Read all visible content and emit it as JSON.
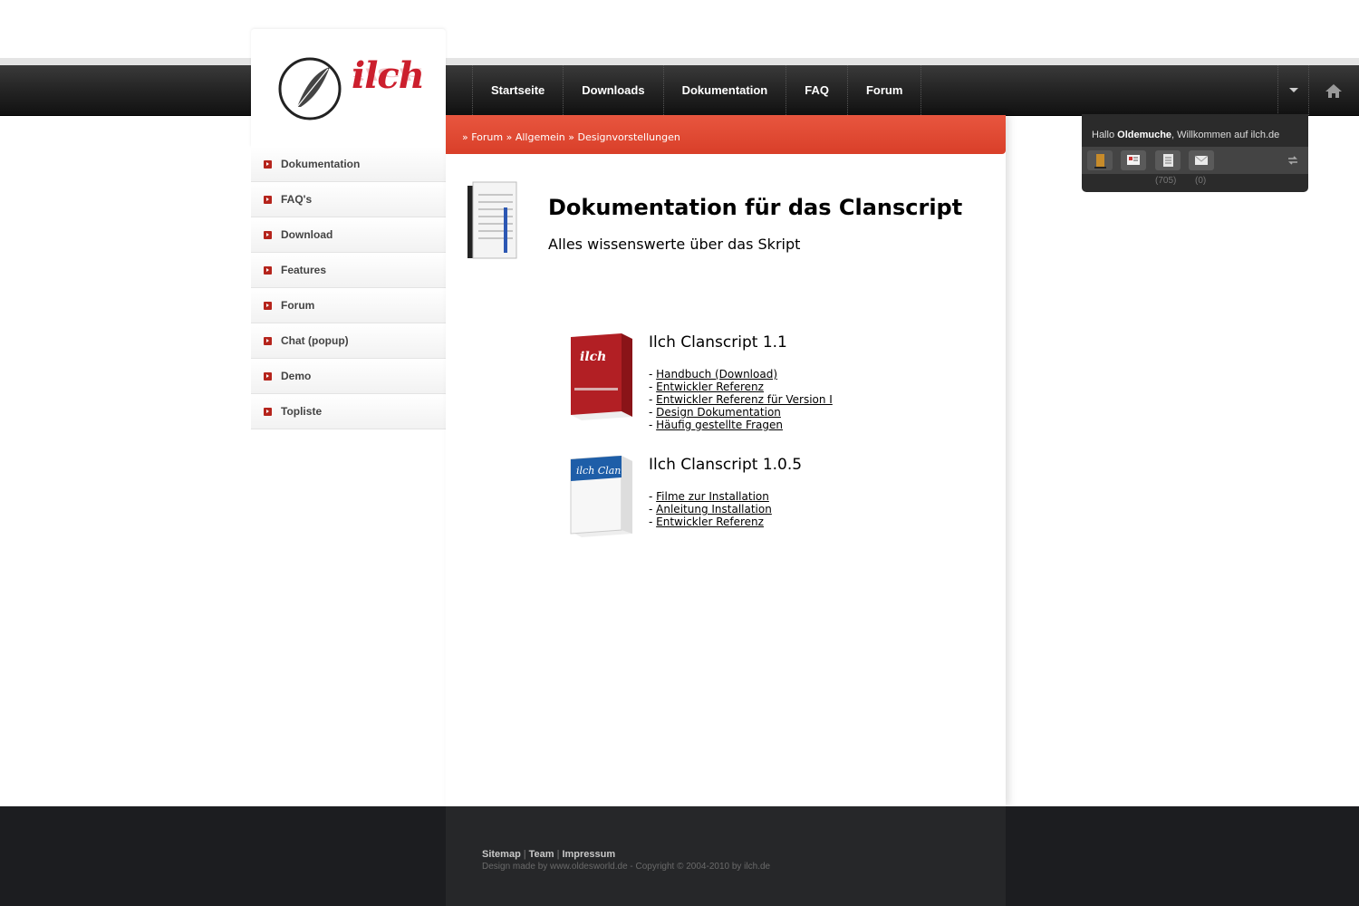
{
  "nav": {
    "items": [
      {
        "label": "Startseite"
      },
      {
        "label": "Downloads"
      },
      {
        "label": "Dokumentation"
      },
      {
        "label": "FAQ"
      },
      {
        "label": "Forum"
      }
    ],
    "dropdown_icon": "chevron-down-icon",
    "home_icon": "home-icon"
  },
  "logo": {
    "text": "ilch"
  },
  "sidebar": {
    "items": [
      {
        "label": "Dokumentation"
      },
      {
        "label": "FAQ's"
      },
      {
        "label": "Download"
      },
      {
        "label": "Features"
      },
      {
        "label": "Forum"
      },
      {
        "label": "Chat (popup)"
      },
      {
        "label": "Demo"
      },
      {
        "label": "Topliste"
      }
    ]
  },
  "breadcrumb": {
    "items": [
      "Forum",
      "Allgemein",
      "Designvorstellungen"
    ]
  },
  "main": {
    "title": "Dokumentation für das Clanscript",
    "subtitle": "Alles wissenswerte über das Skript",
    "products": [
      {
        "name": "Ilch Clanscript 1.1",
        "box_label": "ilch",
        "links": [
          "Handbuch (Download)",
          "Entwickler Referenz",
          "Entwickler Referenz für Version I",
          "Design Dokumentation",
          "Häufig gestellte Fragen"
        ]
      },
      {
        "name": "Ilch Clanscript 1.0.5",
        "box_label": "ilch Clan",
        "links": [
          "Filme zur Installation",
          "Anleitung Installation",
          "Entwickler Referenz"
        ]
      }
    ]
  },
  "user_panel": {
    "greet_prefix": "Hallo",
    "username": "Oldemuche",
    "greet_suffix": ", Willkommen auf ilch.de",
    "count1": "(705)",
    "count2": "(0)"
  },
  "footer": {
    "links": [
      "Sitemap",
      "Team",
      "Impressum"
    ],
    "copyright": "Design made by www.oldesworld.de - Copyright © 2004-2010 by ilch.de"
  },
  "colors": {
    "accent": "#d93f29",
    "logo": "#cc1f2d",
    "navbar": "#262626"
  }
}
